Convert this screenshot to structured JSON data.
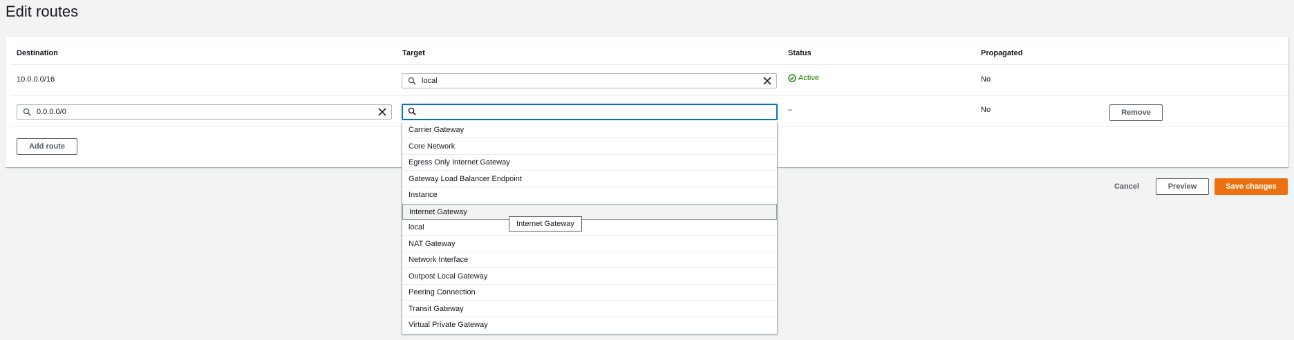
{
  "page": {
    "title": "Edit routes"
  },
  "table": {
    "headers": {
      "destination": "Destination",
      "target": "Target",
      "status": "Status",
      "propagated": "Propagated"
    },
    "rows": [
      {
        "destination": "10.0.0.0/16",
        "target": "local",
        "status": "Active",
        "propagated": "No"
      },
      {
        "destination": "0.0.0.0/0",
        "target": "",
        "status": "–",
        "propagated": "No",
        "remove_label": "Remove"
      }
    ],
    "add_route_label": "Add route"
  },
  "target_dropdown": {
    "options": [
      "Carrier Gateway",
      "Core Network",
      "Egress Only Internet Gateway",
      "Gateway Load Balancer Endpoint",
      "Instance",
      "Internet Gateway",
      "local",
      "NAT Gateway",
      "Network Interface",
      "Outpost Local Gateway",
      "Peering Connection",
      "Transit Gateway",
      "Virtual Private Gateway"
    ],
    "hovered": "Internet Gateway",
    "tooltip": "Internet Gateway"
  },
  "actions": {
    "cancel": "Cancel",
    "preview": "Preview",
    "save": "Save changes"
  },
  "colors": {
    "accent": "#0073bb",
    "primary_button": "#ec7211",
    "status_active": "#1d8102",
    "background": "#f2f3f3"
  },
  "icons": {
    "search": "search-icon",
    "clear": "close-icon",
    "status": "check-circle-icon"
  }
}
